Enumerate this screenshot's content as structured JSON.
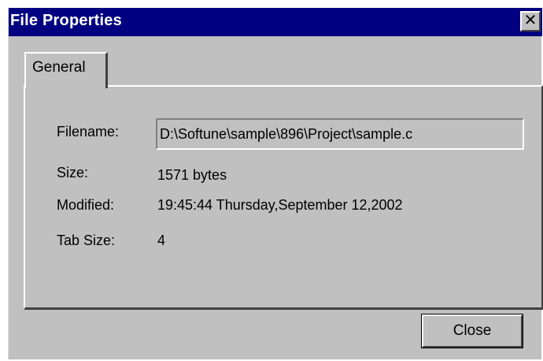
{
  "window": {
    "title": "File Properties",
    "close_glyph": "✕"
  },
  "tabs": [
    {
      "label": "General",
      "active": true
    }
  ],
  "properties": {
    "filename_label": "Filename:",
    "filename_value": "D:\\Softune\\sample\\896\\Project\\sample.c",
    "size_label": "Size:",
    "size_value": "1571 bytes",
    "modified_label": "Modified:",
    "modified_value": "19:45:44 Thursday,September 12,2002",
    "tabsize_label": "Tab Size:",
    "tabsize_value": "4"
  },
  "buttons": {
    "close_label": "Close"
  },
  "colors": {
    "titlebar": "#000080",
    "dialog_bg": "#c0c0c0"
  },
  "icons": {
    "titlebar_close": "close-icon"
  }
}
